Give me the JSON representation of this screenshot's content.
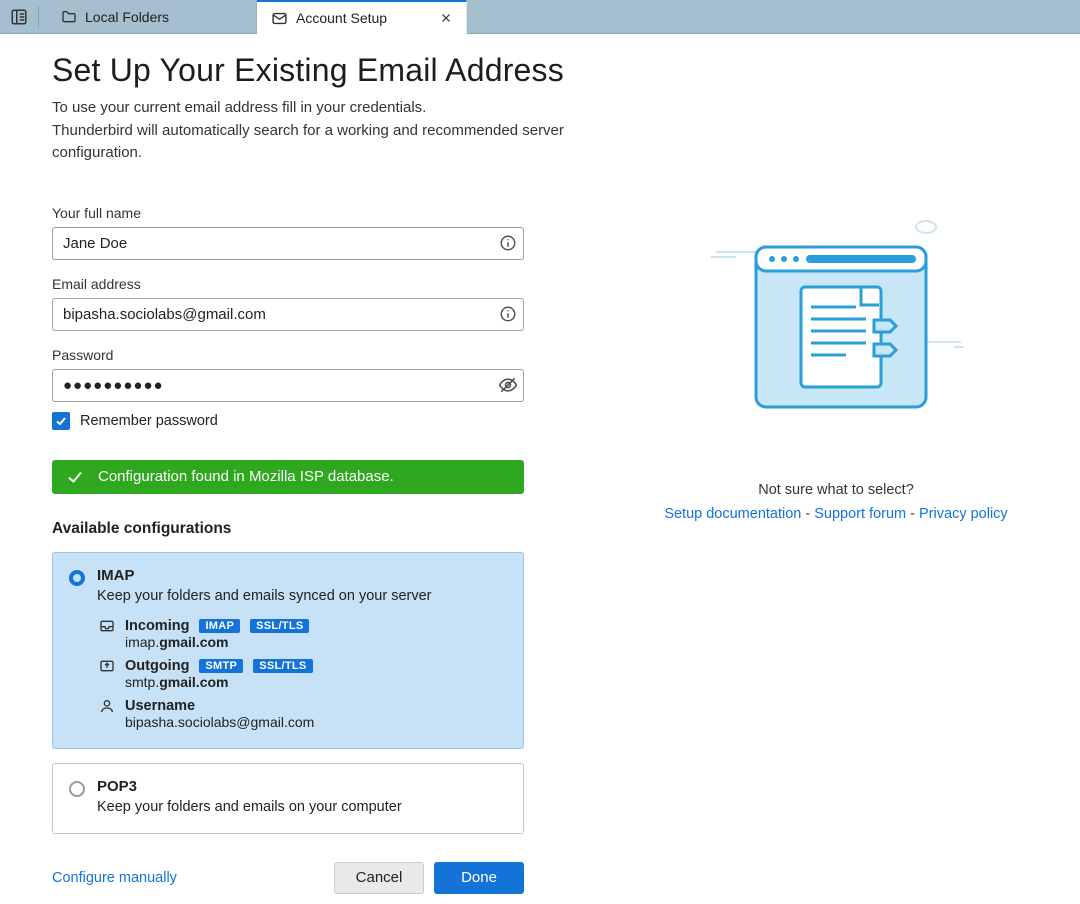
{
  "tabs": {
    "local_folders": "Local Folders",
    "account_setup": "Account Setup"
  },
  "header": {
    "title": "Set Up Your Existing Email Address",
    "subtitle_line1": "To use your current email address fill in your credentials.",
    "subtitle_line2": "Thunderbird will automatically search for a working and recommended server configuration."
  },
  "form": {
    "name_label": "Your full name",
    "name_value": "Jane Doe",
    "email_label": "Email address",
    "email_value": "bipasha.sociolabs@gmail.com",
    "password_label": "Password",
    "password_value": "●●●●●●●●●●",
    "remember_label": "Remember password",
    "remember_checked": true
  },
  "status": {
    "message": "Configuration found in Mozilla ISP database."
  },
  "available_heading": "Available configurations",
  "configs": {
    "imap": {
      "title": "IMAP",
      "desc": "Keep your folders and emails synced on your server",
      "incoming_label": "Incoming",
      "incoming_proto": "IMAP",
      "incoming_sec": "SSL/TLS",
      "incoming_host_prefix": "imap.",
      "incoming_host_domain": "gmail.com",
      "outgoing_label": "Outgoing",
      "outgoing_proto": "SMTP",
      "outgoing_sec": "SSL/TLS",
      "outgoing_host_prefix": "smtp.",
      "outgoing_host_domain": "gmail.com",
      "username_label": "Username",
      "username_value": "bipasha.sociolabs@gmail.com"
    },
    "pop3": {
      "title": "POP3",
      "desc": "Keep your folders and emails on your computer"
    }
  },
  "actions": {
    "configure_manually": "Configure manually",
    "cancel": "Cancel",
    "done": "Done"
  },
  "help": {
    "not_sure": "Not sure what to select?",
    "setup_doc": "Setup documentation",
    "support": "Support forum",
    "privacy": "Privacy policy",
    "sep": " - "
  }
}
